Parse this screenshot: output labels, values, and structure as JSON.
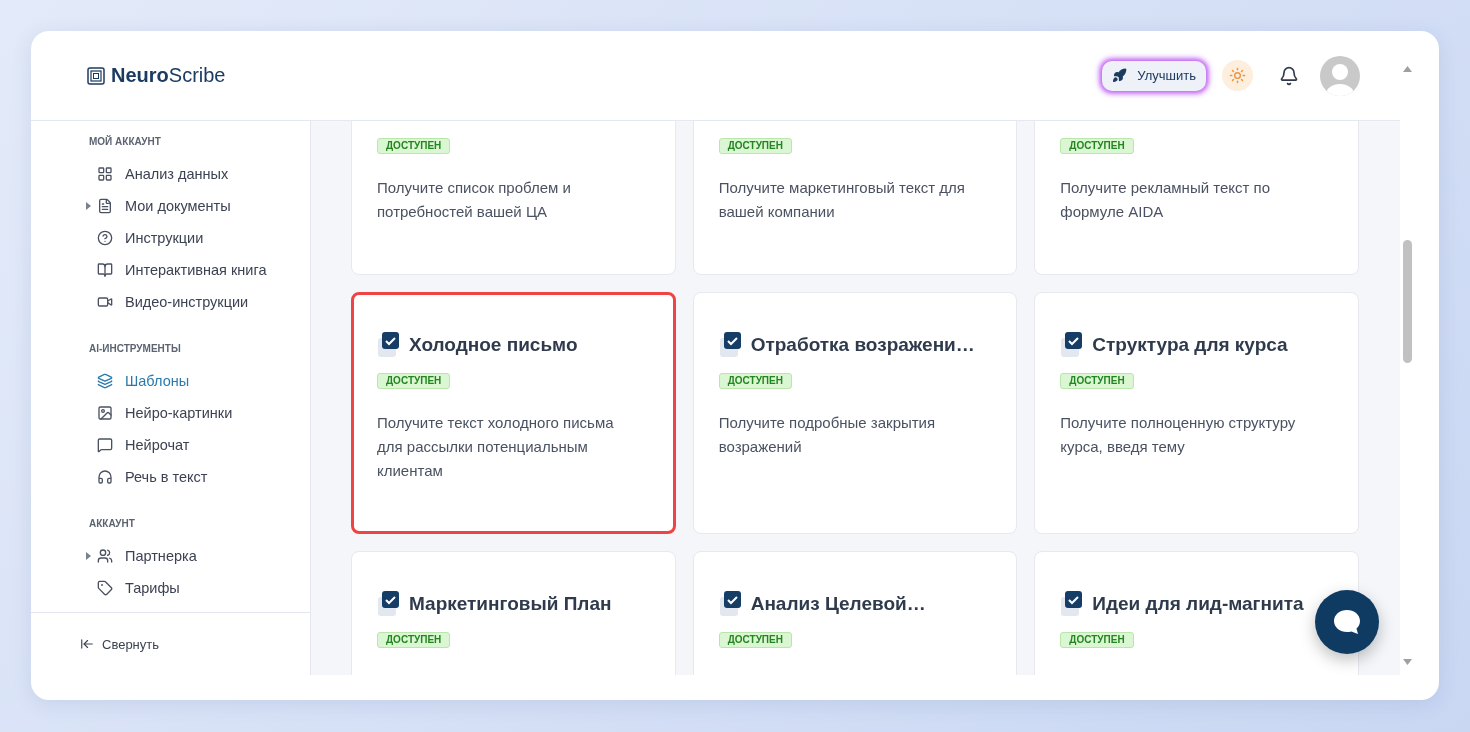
{
  "logo": {
    "text": "**Neuro**Scribe"
  },
  "header": {
    "upgrade_button": "Улучшить"
  },
  "sidebar": {
    "sections": [
      {
        "label": "МОЙ АККАУНТ",
        "items": [
          {
            "label": "Анализ данных",
            "selected": false
          },
          {
            "label": "Мои документы",
            "selected": false,
            "expanded": false
          },
          {
            "label": "Инструкции",
            "selected": false
          },
          {
            "label": "Интерактивная книга",
            "selected": false
          },
          {
            "label": "Видео-инструкции",
            "selected": false
          }
        ]
      },
      {
        "label": "AI-ИНСТРУМЕНТЫ",
        "items": [
          {
            "label": "Шаблоны",
            "selected": true
          },
          {
            "label": "Нейро-картинки",
            "selected": false
          },
          {
            "label": "Нейрочат",
            "selected": false
          },
          {
            "label": "Речь в текст",
            "selected": false
          }
        ]
      },
      {
        "label": "АККАУНТ",
        "items": [
          {
            "label": "Партнерка",
            "selected": false,
            "expanded": false
          },
          {
            "label": "Тарифы",
            "selected": false
          }
        ]
      }
    ],
    "collapse": "Свернуть"
  },
  "cards": [
    {
      "badge": "ДОСТУПЕН",
      "description": "Получите список проблем и потребностей вашей ЦА",
      "highlighted": false
    },
    {
      "badge": "ДОСТУПЕН",
      "description": "Получите маркетинговый текст для вашей компании",
      "highlighted": false
    },
    {
      "badge": "ДОСТУПЕН",
      "description": "Получите рекламный текст по формуле AIDA",
      "highlighted": false
    },
    {
      "title": "Холодное письмо",
      "badge": "ДОСТУПЕН",
      "description": "Получите текст холодного письма для рассылки потенциальным клиентам",
      "highlighted": true
    },
    {
      "title": "Отработка возражени…",
      "badge": "ДОСТУПЕН",
      "description": "Получите подробные закрытия возражений",
      "highlighted": false
    },
    {
      "title": "Структура для курса",
      "badge": "ДОСТУПЕН",
      "description": "Получите полноценную структуру курса, введя тему",
      "highlighted": false
    },
    {
      "title": "Маркетинговый План",
      "badge": "ДОСТУПЕН",
      "highlighted": false
    },
    {
      "title": "Анализ Целевой…",
      "badge": "ДОСТУПЕН",
      "highlighted": false
    },
    {
      "title": "Идеи для лид-магнита",
      "badge": "ДОСТУПЕН",
      "highlighted": false
    }
  ]
}
